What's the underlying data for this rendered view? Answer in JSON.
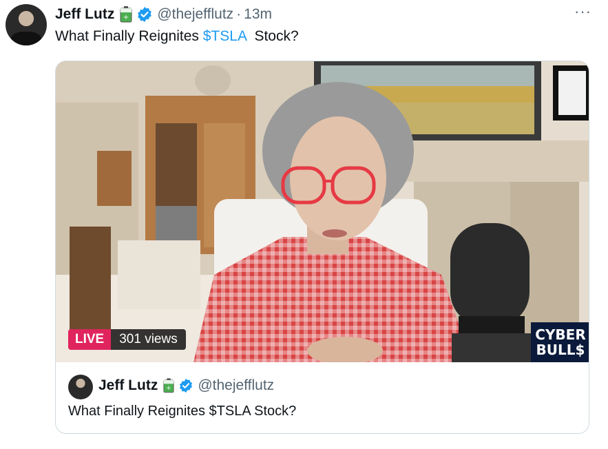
{
  "tweet": {
    "author_name": "Jeff Lutz",
    "handle": "@thejefflutz",
    "separator": "·",
    "time": "13m",
    "more_label": "···",
    "text_before": "What Finally Reignites ",
    "cashtag": "$TSLA",
    "text_after": "  Stock?"
  },
  "video": {
    "live_label": "LIVE",
    "views_label": "301 views",
    "watermark_line1": "CYBER",
    "watermark_line2": "BULL$"
  },
  "quoted": {
    "author_name": "Jeff Lutz",
    "handle": "@thejefflutz",
    "text": "What Finally Reignites $TSLA Stock?"
  },
  "icons": {
    "battery": "battery-icon",
    "verified": "verified-badge-icon",
    "more": "more-dots-icon"
  },
  "colors": {
    "accent": "#1d9bf0",
    "live": "#e0245e",
    "muted": "#536471"
  }
}
